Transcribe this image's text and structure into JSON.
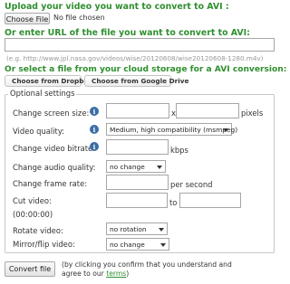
{
  "upload": {
    "heading": "Upload your video you want to convert to AVI :",
    "choose_file_label": "Choose File",
    "file_status": "No file chosen"
  },
  "url": {
    "heading": "Or enter URL of the file you want to convert to AVI:",
    "input_value": "",
    "example": "(e.g. http://www.jpl.nasa.gov/videos/wise/20120608/wise20120608-1280.m4v)"
  },
  "cloud": {
    "heading": "Or select a file from your cloud storage for a AVI conversion:",
    "dropbox_label": "Choose from Dropbox",
    "drive_label": "Choose from Google Drive"
  },
  "settings": {
    "legend": "Optional settings",
    "screen_size_label": "Change screen size:",
    "screen_size_x": "x",
    "screen_size_unit": "pixels",
    "quality_label": "Video quality:",
    "quality_value": "Medium, high compatibility (msmpeg)",
    "bitrate_label": "Change video bitrate:",
    "bitrate_unit": "kbps",
    "audio_quality_label": "Change audio quality:",
    "audio_quality_value": "no change",
    "frame_rate_label": "Change frame rate:",
    "frame_rate_unit": "per second",
    "cut_label": "Cut video:",
    "cut_to": "to",
    "cut_format": "(00:00:00)",
    "rotate_label": "Rotate video:",
    "rotate_value": "no rotation",
    "mirror_label": "Mirror/flip video:",
    "mirror_value": "no change"
  },
  "footer": {
    "convert_label": "Convert file",
    "note_line1": "(by clicking you confirm that you understand and",
    "note_line2_prefix": "agree to our ",
    "terms_link": "terms",
    "note_line2_suffix": ")"
  },
  "icons": {
    "info": "info-icon",
    "dropbox": "dropbox-icon",
    "drive": "google-drive-icon"
  },
  "colors": {
    "heading_green": "#2f8f2f",
    "info_blue": "#3a6ea5"
  }
}
